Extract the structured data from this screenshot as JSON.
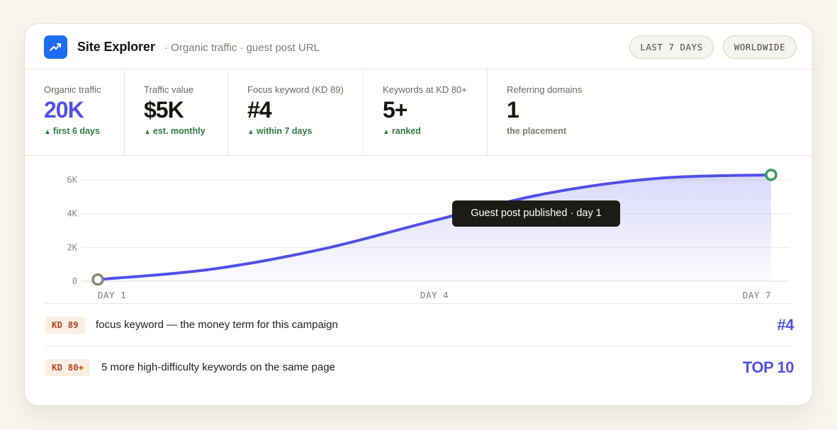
{
  "header": {
    "title": "Site Explorer",
    "subtitle": "· Organic traffic · guest post URL",
    "range_label": "LAST 7 DAYS",
    "region_label": "WORLDWIDE",
    "icon": "trend-line-icon"
  },
  "metrics": [
    {
      "label": "Organic traffic",
      "value": "20K",
      "note": "first 6 days",
      "trend": "up"
    },
    {
      "label": "Traffic value",
      "value": "$5K",
      "note": "est. monthly",
      "trend": "up"
    },
    {
      "label": "Focus keyword (KD 89)",
      "value": "#4",
      "note": "within 7 days",
      "trend": "up"
    },
    {
      "label": "Keywords at KD 80+",
      "value": "5+",
      "note": "ranked",
      "trend": "up"
    },
    {
      "label": "Referring domains",
      "value": "1",
      "note": "the placement",
      "trend": "none"
    }
  ],
  "chart_data": {
    "type": "line",
    "x": [
      1,
      2,
      3,
      4,
      5,
      6,
      7
    ],
    "x_tick_labels": [
      "DAY 1",
      "DAY 4",
      "DAY 7"
    ],
    "x_tick_positions": [
      1,
      4,
      7
    ],
    "y_tick_labels": [
      "0",
      "2K",
      "4K",
      "6K"
    ],
    "y_tick_values": [
      0,
      2000,
      4000,
      6000
    ],
    "ylim": [
      0,
      6000
    ],
    "series": [
      {
        "values": [
          100,
          700,
          1900,
          3600,
          5200,
          6100,
          6300
        ],
        "color": "#5150e8"
      }
    ],
    "grid": true,
    "annotation": "Guest post published · day 1",
    "colors": {
      "line": "#5150e8",
      "start_marker": "#8a8676",
      "end_marker": "#3f9a5c"
    }
  },
  "rows": [
    {
      "badge": "KD 89",
      "text": "focus keyword — the money term for this campaign",
      "value": "#4"
    },
    {
      "badge": "KD 80+",
      "text": "5 more high-difficulty keywords on the same page",
      "value": "TOP 10"
    }
  ],
  "colors": {
    "accent": "#5150e8",
    "positive": "#2f7a44",
    "logo": "#1e6cf2",
    "badge_bg": "#fbeee2",
    "badge_text": "#b3481f"
  }
}
